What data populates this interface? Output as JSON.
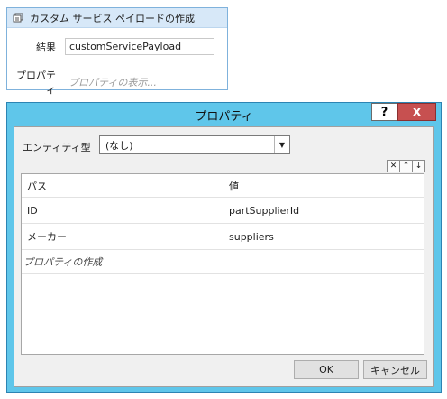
{
  "activity": {
    "title": "カスタム サービス ペイロードの作成",
    "icon": "payload-activity-icon",
    "result_label": "結果",
    "result_value": "customServicePayload",
    "properties_label": "プロパティ",
    "properties_placeholder": "プロパティの表示..."
  },
  "dialog": {
    "title": "プロパティ",
    "help_label": "?",
    "close_label": "x",
    "entity_label": "エンティティ型",
    "entity_value": "(なし)",
    "tools": [
      "delete-icon",
      "arrow-up-icon",
      "arrow-down-icon"
    ],
    "grid": {
      "headers": [
        "パス",
        "値"
      ],
      "rows": [
        {
          "path": "ID",
          "value": "partSupplierId"
        },
        {
          "path": "メーカー",
          "value": "suppliers"
        }
      ],
      "add_row_label": "プロパティの作成"
    },
    "ok_label": "OK",
    "cancel_label": "キャンセル"
  },
  "colors": {
    "titlebar": "#5fc6ea",
    "close_button": "#c75050",
    "activity_header": "#d7e8f8",
    "activity_border": "#7fb2dc"
  }
}
